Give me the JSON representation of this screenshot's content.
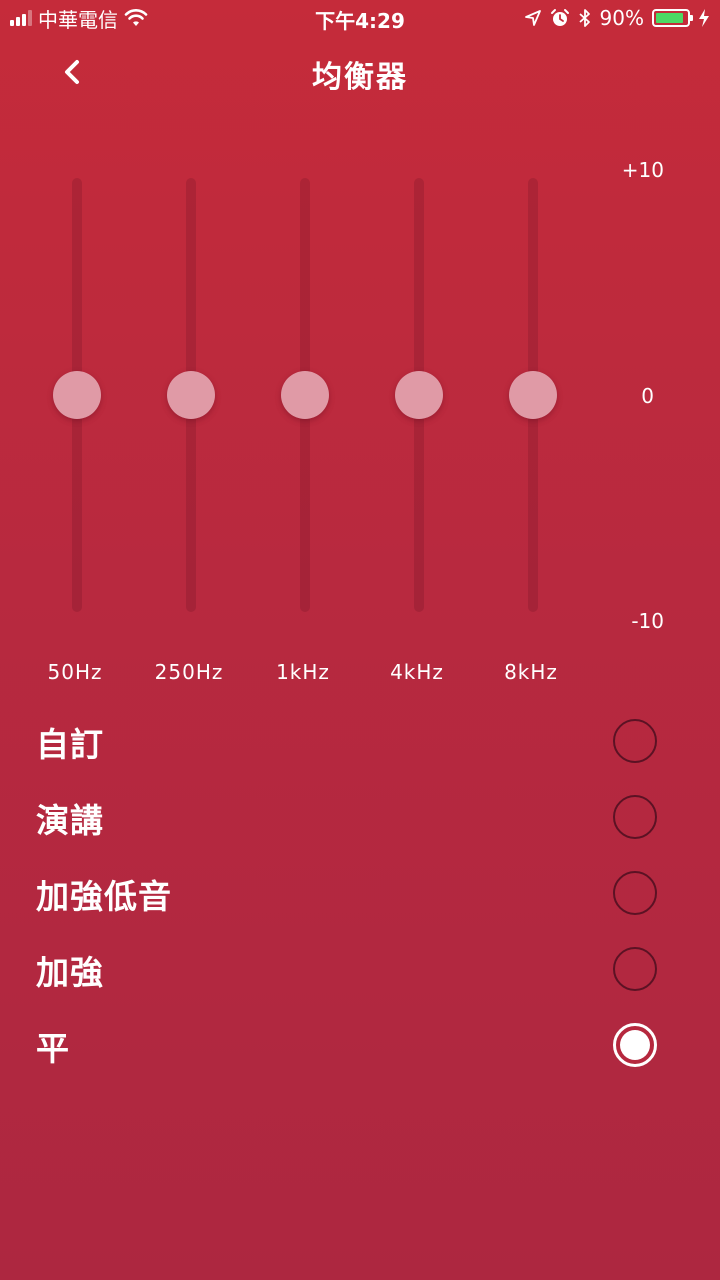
{
  "status_bar": {
    "carrier": "中華電信",
    "time": "下午4:29",
    "battery": "90%",
    "battery_level": 0.9,
    "battery_color": "#4cd964",
    "icons": [
      "signal-icon",
      "wifi-icon",
      "location-icon",
      "alarm-icon",
      "bluetooth-icon",
      "battery-icon",
      "charging-icon"
    ]
  },
  "nav": {
    "title": "均衡器",
    "back_icon": "chevron-left-icon"
  },
  "equalizer": {
    "scale": {
      "max": "+10",
      "mid": "0",
      "min": "-10"
    },
    "range": [
      -10,
      10
    ],
    "bands": [
      {
        "label": "50Hz",
        "value": 0
      },
      {
        "label": "250Hz",
        "value": 0
      },
      {
        "label": "1kHz",
        "value": 0
      },
      {
        "label": "4kHz",
        "value": 0
      },
      {
        "label": "8kHz",
        "value": 0
      }
    ]
  },
  "presets": [
    {
      "label": "自訂",
      "selected": false
    },
    {
      "label": "演講",
      "selected": false
    },
    {
      "label": "加強低音",
      "selected": false
    },
    {
      "label": "加強",
      "selected": false
    },
    {
      "label": "平",
      "selected": true
    }
  ]
}
